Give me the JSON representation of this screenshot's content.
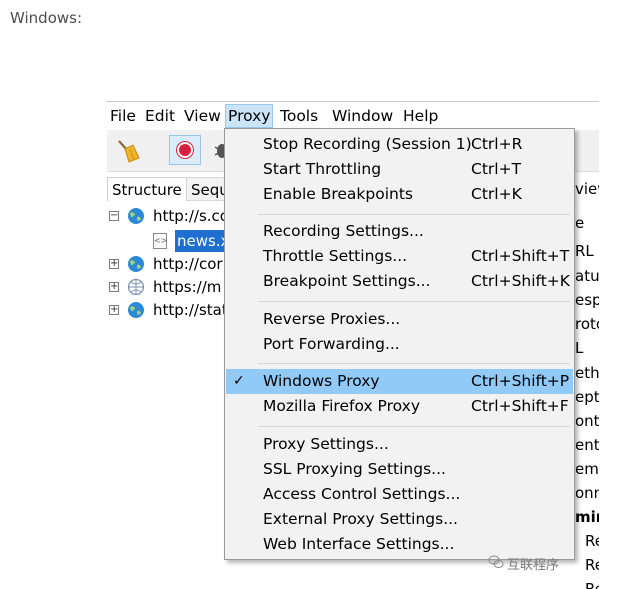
{
  "caption": "Windows:",
  "menubar": {
    "items": [
      "File",
      "Edit",
      "View",
      "Proxy",
      "Tools",
      "Window",
      "Help"
    ]
  },
  "tabs": {
    "structure": "Structure",
    "sequence": "Sequ"
  },
  "tree": {
    "rows": [
      "http://s.co",
      "news.x",
      "http://cor",
      "https://m",
      "http://stat"
    ]
  },
  "right_column": [
    "view",
    "e",
    "RL",
    "atus",
    "espo",
    "roto",
    "L",
    "eth",
    "ept",
    "onte",
    "ent",
    "emo",
    "onn",
    "min",
    "Re",
    "Re",
    "Re"
  ],
  "proxy_menu": {
    "items": [
      {
        "label": "Stop Recording (Session 1)",
        "shortcut": "Ctrl+R"
      },
      {
        "label": "Start Throttling",
        "shortcut": "Ctrl+T"
      },
      {
        "label": "Enable Breakpoints",
        "shortcut": "Ctrl+K"
      },
      {
        "label": "Recording Settings...",
        "shortcut": ""
      },
      {
        "label": "Throttle Settings...",
        "shortcut": "Ctrl+Shift+T"
      },
      {
        "label": "Breakpoint Settings...",
        "shortcut": "Ctrl+Shift+K"
      },
      {
        "label": "Reverse Proxies...",
        "shortcut": ""
      },
      {
        "label": "Port Forwarding...",
        "shortcut": ""
      },
      {
        "label": "Windows Proxy",
        "shortcut": "Ctrl+Shift+P",
        "checked": true
      },
      {
        "label": "Mozilla Firefox Proxy",
        "shortcut": "Ctrl+Shift+F"
      },
      {
        "label": "Proxy Settings...",
        "shortcut": ""
      },
      {
        "label": "SSL Proxying Settings...",
        "shortcut": ""
      },
      {
        "label": "Access Control Settings...",
        "shortcut": ""
      },
      {
        "label": "External Proxy Settings...",
        "shortcut": ""
      },
      {
        "label": "Web Interface Settings...",
        "shortcut": ""
      }
    ],
    "checkmark": "✓"
  },
  "watermark": "互联程序",
  "colors": {
    "highlight": "#91c9f7",
    "selection": "#1e6fd0",
    "record": "#d81f3c",
    "globe": "#2b8ad8"
  }
}
